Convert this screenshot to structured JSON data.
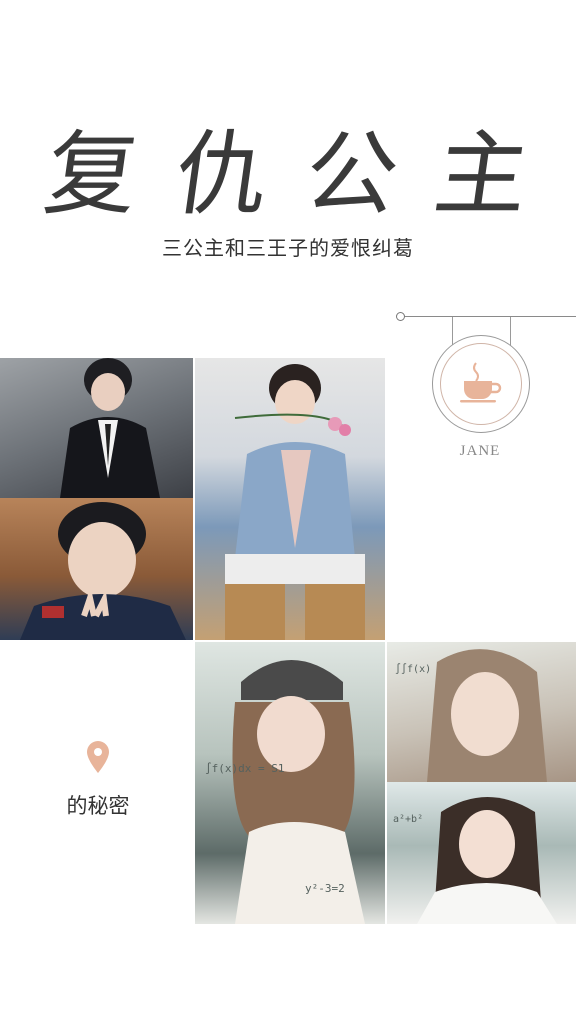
{
  "cover": {
    "title": "复仇公主",
    "subtitle": "三公主和三王子的爱恨纠葛",
    "author": "JANE",
    "location_text": "的秘密"
  },
  "icons": {
    "badge": "coffee-cup-icon",
    "location": "map-pin-icon"
  },
  "colors": {
    "accent": "#e8b49a",
    "text": "#333333"
  }
}
